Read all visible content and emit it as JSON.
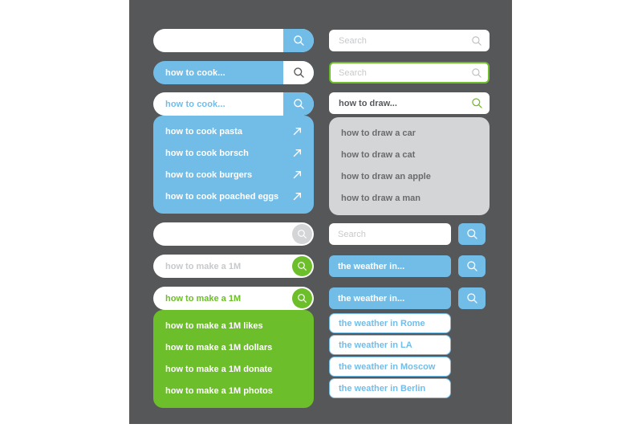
{
  "theme": {
    "page_background": "#ffffff",
    "panel_background": "#565759",
    "blue": "#72bde8",
    "green": "#6cbe2a",
    "gray": "#d4d5d7",
    "dark_text": "#58595b",
    "placeholder_gray": "#c8c9cb",
    "white": "#ffffff"
  },
  "icons": {
    "search": "search-icon",
    "arrow": "arrow-up-right-icon"
  },
  "left_column": {
    "group_cook": {
      "bar_empty": {
        "value": "",
        "placeholder": ""
      },
      "bar_filled_blue": {
        "value": "how to cook..."
      },
      "bar_filled_white": {
        "value": "how to cook..."
      },
      "suggestions": [
        "how to cook pasta",
        "how to cook borsch",
        "how to cook burgers",
        "how to cook poached eggs"
      ]
    },
    "group_make": {
      "bar_empty": {
        "value": "",
        "placeholder": ""
      },
      "bar_placeholder": {
        "value": "how to make a 1M"
      },
      "bar_filled": {
        "value": "how to make a 1M"
      },
      "suggestions": [
        "how to make a 1M likes",
        "how to make a 1M dollars",
        "how to make a 1M donate",
        "how to make a 1M photos"
      ]
    }
  },
  "right_column": {
    "group_draw": {
      "field_plain": {
        "value": "",
        "placeholder": "Search"
      },
      "field_focused": {
        "value": "",
        "placeholder": "Search"
      },
      "field_filled": {
        "value": "how to draw..."
      },
      "suggestions": [
        "how to draw a car",
        "how to draw a cat",
        "how to draw an apple",
        "how to draw a man"
      ]
    },
    "group_weather": {
      "field_plain": {
        "value": "",
        "placeholder": "Search"
      },
      "field_filled_a": {
        "value": "the weather in..."
      },
      "field_filled_b": {
        "value": "the weather in..."
      },
      "suggestions": [
        "the weather in Rome",
        "the weather in LA",
        "the weather in Moscow",
        "the weather in Berlin"
      ]
    }
  }
}
